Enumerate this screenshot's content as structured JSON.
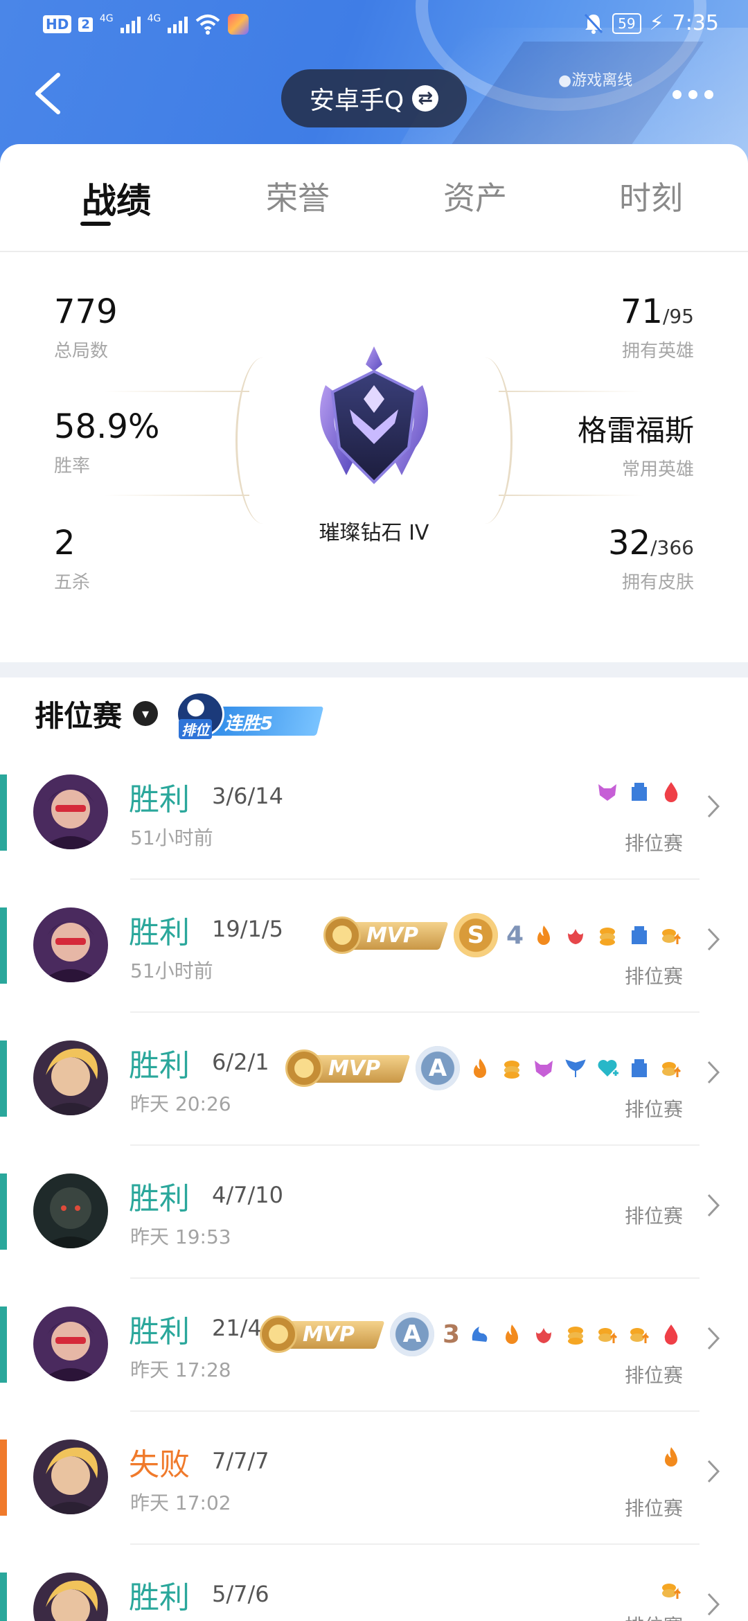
{
  "status": {
    "hd": "HD",
    "sim": "2",
    "net1": "4G",
    "net2": "4G",
    "battery": "59",
    "time": "7:35"
  },
  "header": {
    "account": "安卓手Q",
    "offline": "●游戏离线"
  },
  "tabs": [
    "战绩",
    "荣誉",
    "资产",
    "时刻"
  ],
  "stats": {
    "total_games": "779",
    "total_games_label": "总局数",
    "win_rate": "58.9%",
    "win_rate_label": "胜率",
    "penta": "2",
    "penta_label": "五杀",
    "heroes_owned": "71",
    "heroes_total": "/95",
    "heroes_label": "拥有英雄",
    "common_hero": "格雷福斯",
    "common_hero_label": "常用英雄",
    "skins_owned": "32",
    "skins_total": "/366",
    "skins_label": "拥有皮肤",
    "rank": "璀璨钻石 IV"
  },
  "mode": {
    "title": "排位赛",
    "badge_icon": "排位",
    "streak": "连胜5"
  },
  "matches": [
    {
      "result": "胜利",
      "kda": "3/6/14",
      "time": "51小时前",
      "mode": "排位赛",
      "outcome": "win"
    },
    {
      "result": "胜利",
      "kda": "19/1/5",
      "time": "51小时前",
      "mode": "排位赛",
      "outcome": "win",
      "mvp": "MVP",
      "medal": "S",
      "streak": "4"
    },
    {
      "result": "胜利",
      "kda": "6/2/1",
      "time": "昨天 20:26",
      "mode": "排位赛",
      "outcome": "win",
      "mvp": "MVP",
      "medal": "A"
    },
    {
      "result": "胜利",
      "kda": "4/7/10",
      "time": "昨天 19:53",
      "mode": "排位赛",
      "outcome": "win"
    },
    {
      "result": "胜利",
      "kda": "21/4/3",
      "time": "昨天 17:28",
      "mode": "排位赛",
      "outcome": "win",
      "mvp": "MVP",
      "medal": "A",
      "streak": "3"
    },
    {
      "result": "失败",
      "kda": "7/7/7",
      "time": "昨天 17:02",
      "mode": "排位赛",
      "outcome": "loss"
    },
    {
      "result": "胜利",
      "kda": "5/7/6",
      "time": "",
      "mode": "排位赛",
      "outcome": "win"
    }
  ],
  "colors": {
    "win": "#2aa79b",
    "loss": "#f07a2b",
    "header_blue": "#3f7de6"
  }
}
